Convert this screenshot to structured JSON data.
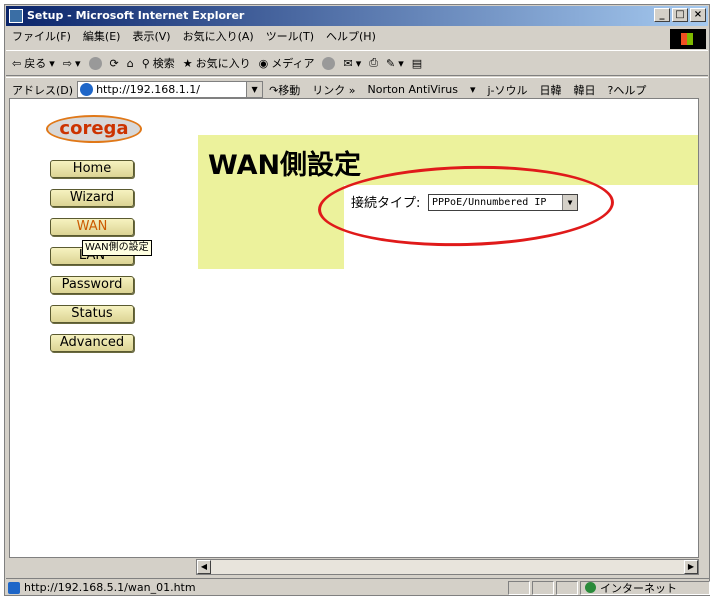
{
  "window": {
    "title": "Setup - Microsoft Internet Explorer",
    "controls": [
      "_",
      "□",
      "×"
    ]
  },
  "menu": [
    "ファイル(F)",
    "編集(E)",
    "表示(V)",
    "お気に入り(A)",
    "ツール(T)",
    "ヘルプ(H)"
  ],
  "toolbar": {
    "back": "戻る",
    "search": "検索",
    "favorites": "お気に入り",
    "media": "メディア"
  },
  "address": {
    "label": "アドレス(D)",
    "url": "http://192.168.1.1/",
    "go": "移動",
    "links": "リンク »",
    "norton": "Norton AntiVirus",
    "seoul": "j-ソウル",
    "japan_korea": "日韓",
    "korea_japan": "韓日",
    "help": "ヘルプ"
  },
  "page": {
    "logo": "corega",
    "nav": [
      "Home",
      "Wizard",
      "WAN",
      "LAN",
      "Password",
      "Status",
      "Advanced"
    ],
    "active_nav": "WAN",
    "tooltip": "WAN側の設定",
    "heading": "WAN側設定",
    "connection_label": "接続タイプ:",
    "connection_value": "PPPoE/Unnumbered IP"
  },
  "status": {
    "url": "http://192.168.5.1/wan_01.htm",
    "zone": "インターネット"
  },
  "colors": {
    "band": "#ecf29c",
    "highlight_ring": "#e01a1a",
    "active_nav_text": "#cc5a00",
    "logo_text": "#cc3300"
  }
}
